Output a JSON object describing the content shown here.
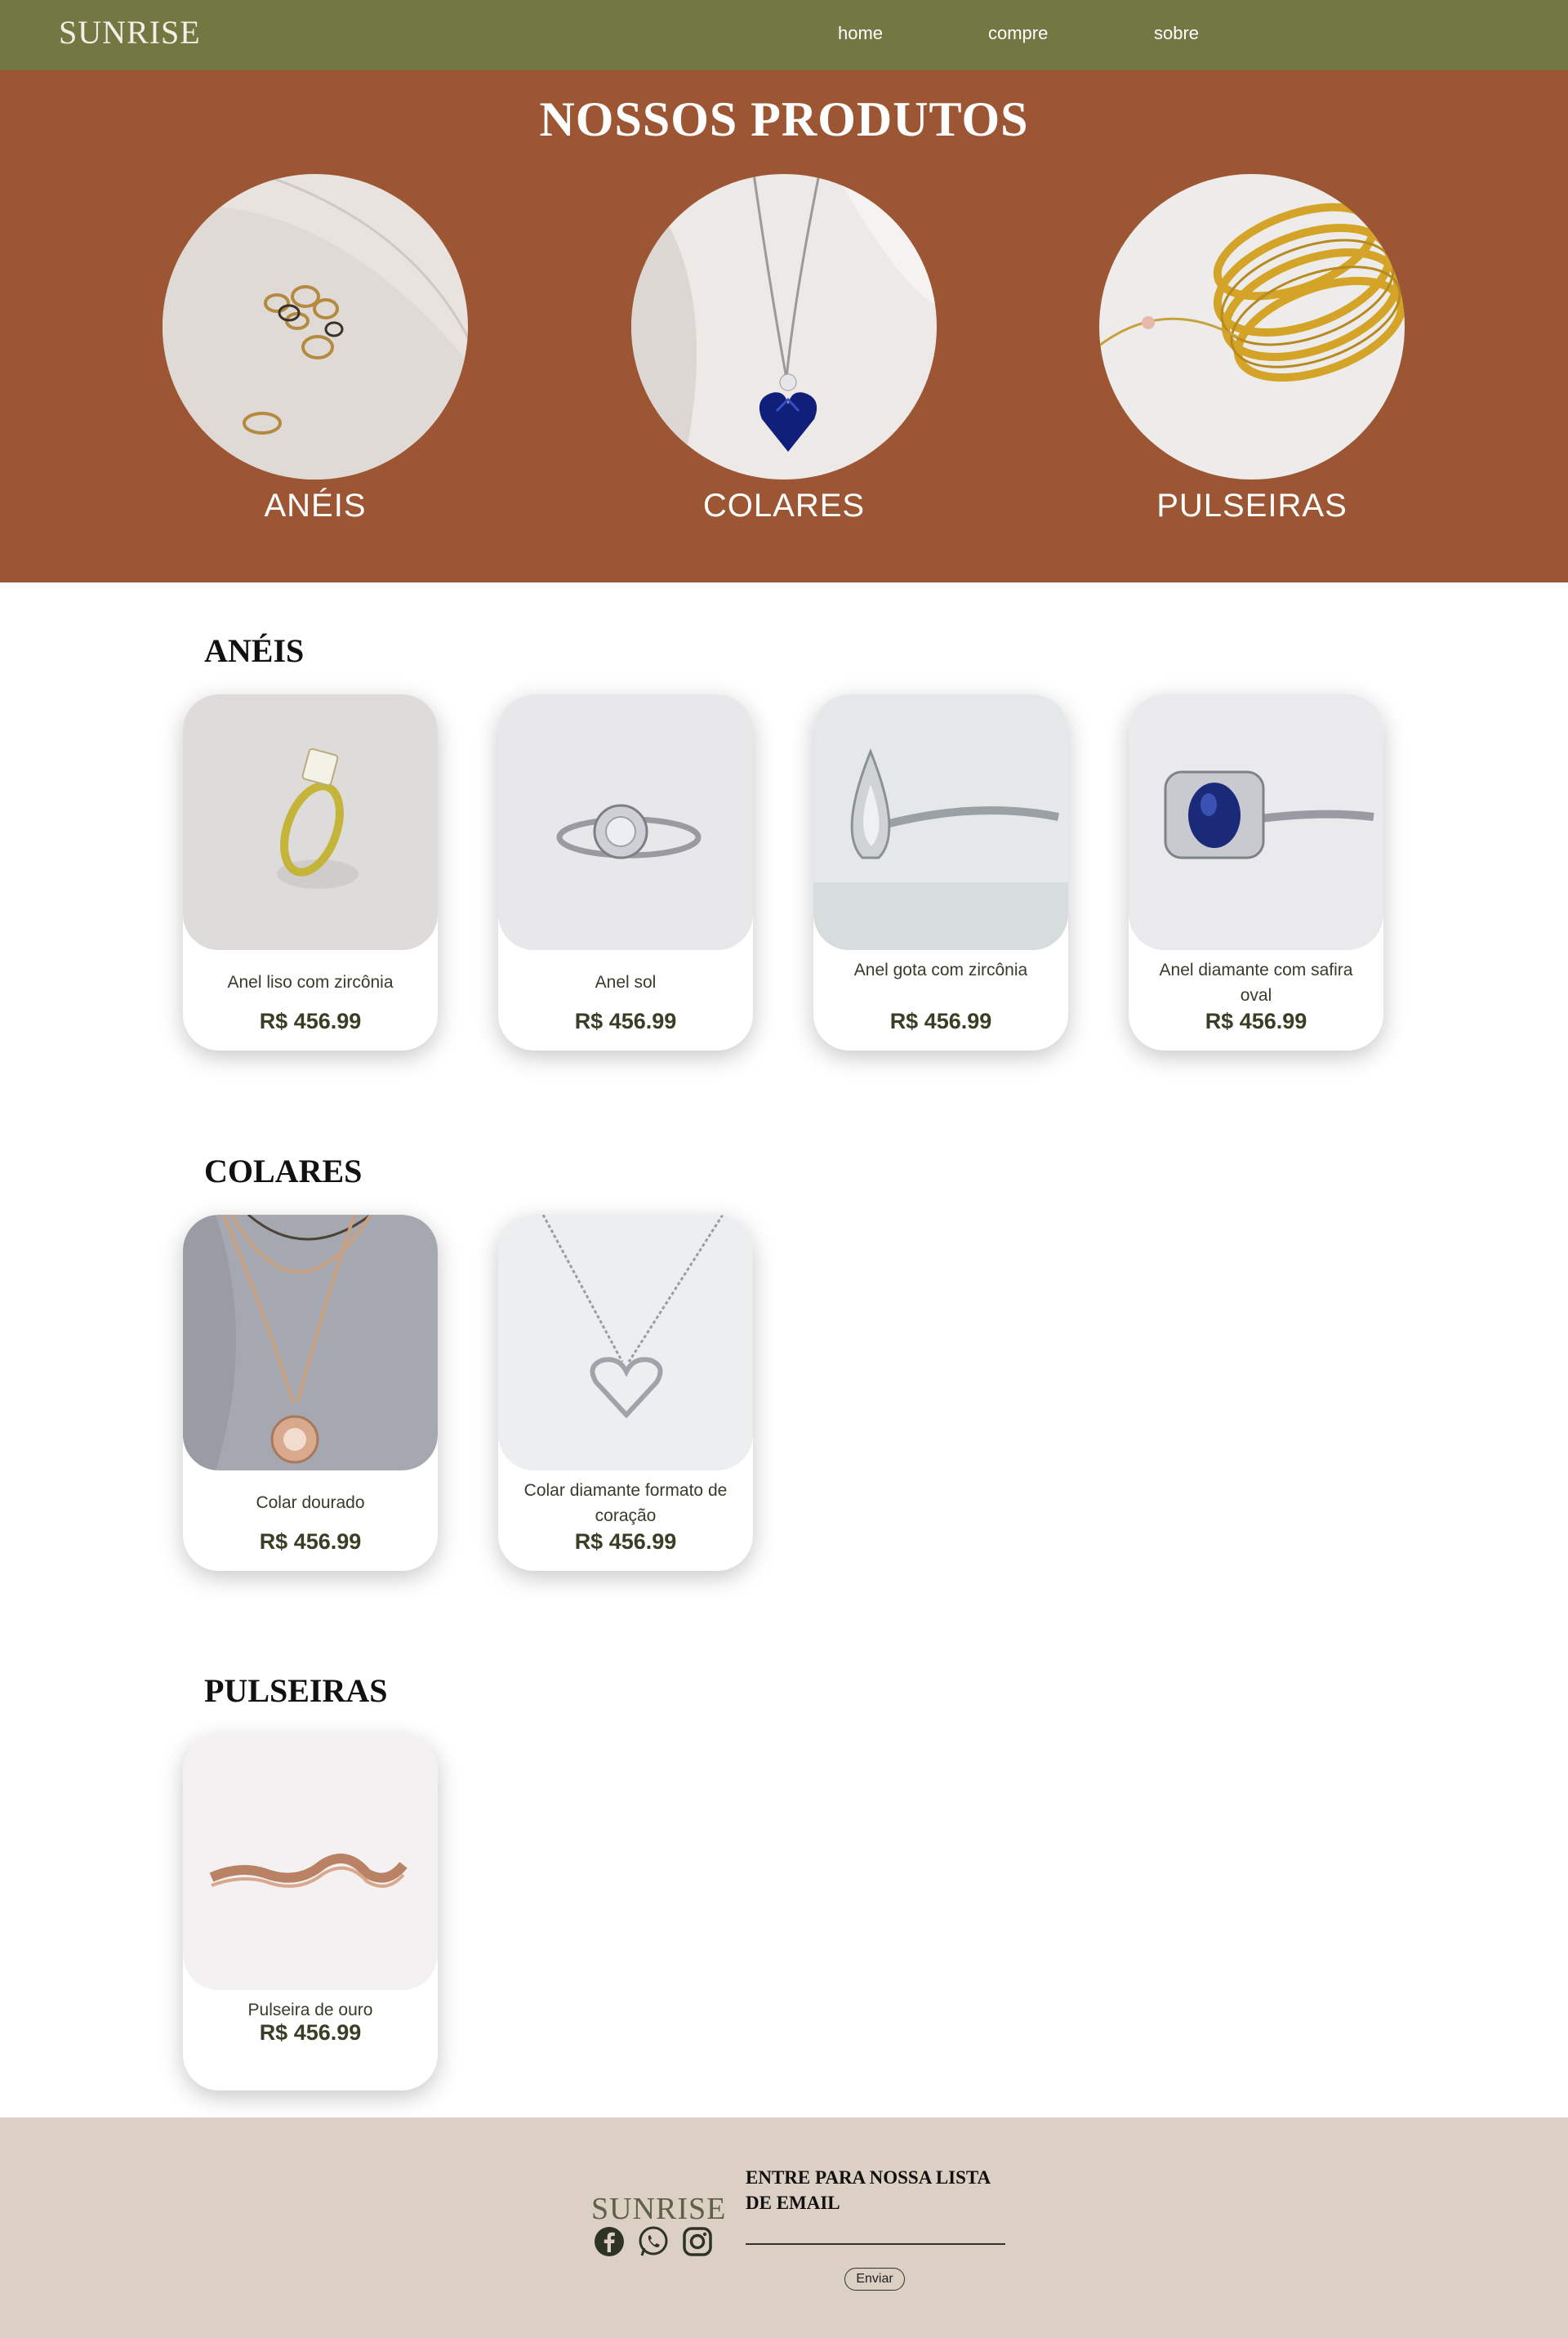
{
  "nav": {
    "logo": "SUNRISE",
    "links": [
      "home",
      "compre",
      "sobre"
    ]
  },
  "hero": {
    "title": "NOSSOS PRODUTOS",
    "categories": [
      "ANÉIS",
      "COLARES",
      "PULSEIRAS"
    ]
  },
  "sections": {
    "aneis": {
      "title": "ANÉIS",
      "products": [
        {
          "name": "Anel liso com zircônia",
          "price": "R$ 456.99"
        },
        {
          "name": "Anel sol",
          "price": "R$ 456.99"
        },
        {
          "name": "Anel gota com zircônia",
          "price": "R$ 456.99"
        },
        {
          "name": "Anel diamante com safira oval",
          "price": "R$ 456.99"
        }
      ]
    },
    "colares": {
      "title": "COLARES",
      "products": [
        {
          "name": "Colar dourado",
          "price": "R$ 456.99"
        },
        {
          "name": "Colar diamante formato de coração",
          "price": "R$ 456.99"
        }
      ]
    },
    "pulseiras": {
      "title": "PULSEIRAS",
      "products": [
        {
          "name": "Pulseira de ouro",
          "price": "R$ 456.99"
        }
      ]
    }
  },
  "footer": {
    "logo": "SUNRISE",
    "newsletter_title": "ENTRE PARA NOSSA LISTA DE EMAIL",
    "email_placeholder": "",
    "send_label": "Enviar",
    "social_icons": [
      "facebook-icon",
      "whatsapp-icon",
      "instagram-icon"
    ]
  },
  "colors": {
    "nav_bg": "#737843",
    "hero_bg": "#9c5634",
    "footer_bg": "#dccfc4",
    "price_text": "#3b3d25"
  }
}
